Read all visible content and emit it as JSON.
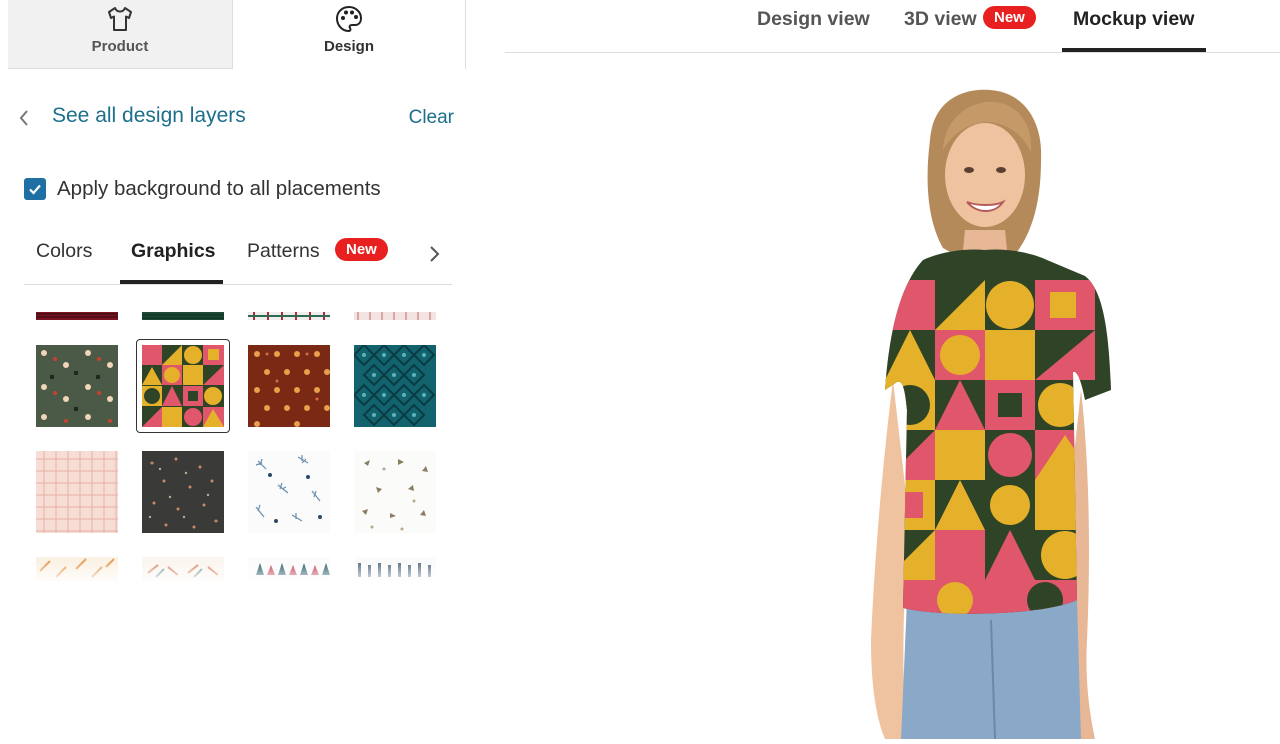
{
  "mode_tabs": [
    {
      "label": "Product",
      "icon": "tshirt-icon"
    },
    {
      "label": "Design",
      "icon": "palette-icon"
    }
  ],
  "back": {
    "label": "See all design layers"
  },
  "clear_label": "Clear",
  "apply_background": {
    "label": "Apply background to all placements",
    "checked": true
  },
  "sub_tabs": [
    {
      "label": "Colors"
    },
    {
      "label": "Graphics",
      "active": true
    },
    {
      "label": "Patterns",
      "badge": "New"
    }
  ],
  "view_tabs": [
    {
      "label": "Design view"
    },
    {
      "label": "3D view",
      "badge": "New"
    },
    {
      "label": "Mockup view",
      "active": true
    }
  ],
  "colors": {
    "accent": "#1d6f8c",
    "checkbox": "#1e6fa3",
    "badge": "#e8201f",
    "pattern_green": "#3d5a34",
    "pattern_pink": "#e0566a",
    "pattern_yellow": "#e6b12a"
  },
  "patterns": {
    "selected_index": 1,
    "visible_rows": 4
  }
}
